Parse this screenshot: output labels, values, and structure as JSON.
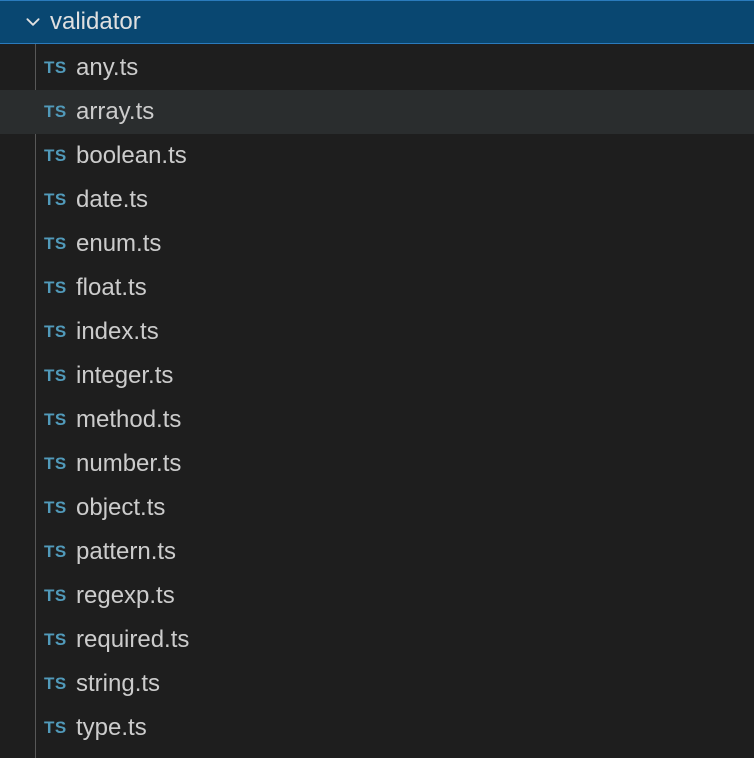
{
  "folder": {
    "name": "validator",
    "expanded": true
  },
  "files": [
    {
      "badge": "TS",
      "name": "any.ts",
      "selected": false
    },
    {
      "badge": "TS",
      "name": "array.ts",
      "selected": true
    },
    {
      "badge": "TS",
      "name": "boolean.ts",
      "selected": false
    },
    {
      "badge": "TS",
      "name": "date.ts",
      "selected": false
    },
    {
      "badge": "TS",
      "name": "enum.ts",
      "selected": false
    },
    {
      "badge": "TS",
      "name": "float.ts",
      "selected": false
    },
    {
      "badge": "TS",
      "name": "index.ts",
      "selected": false
    },
    {
      "badge": "TS",
      "name": "integer.ts",
      "selected": false
    },
    {
      "badge": "TS",
      "name": "method.ts",
      "selected": false
    },
    {
      "badge": "TS",
      "name": "number.ts",
      "selected": false
    },
    {
      "badge": "TS",
      "name": "object.ts",
      "selected": false
    },
    {
      "badge": "TS",
      "name": "pattern.ts",
      "selected": false
    },
    {
      "badge": "TS",
      "name": "regexp.ts",
      "selected": false
    },
    {
      "badge": "TS",
      "name": "required.ts",
      "selected": false
    },
    {
      "badge": "TS",
      "name": "string.ts",
      "selected": false
    },
    {
      "badge": "TS",
      "name": "type.ts",
      "selected": false
    }
  ]
}
